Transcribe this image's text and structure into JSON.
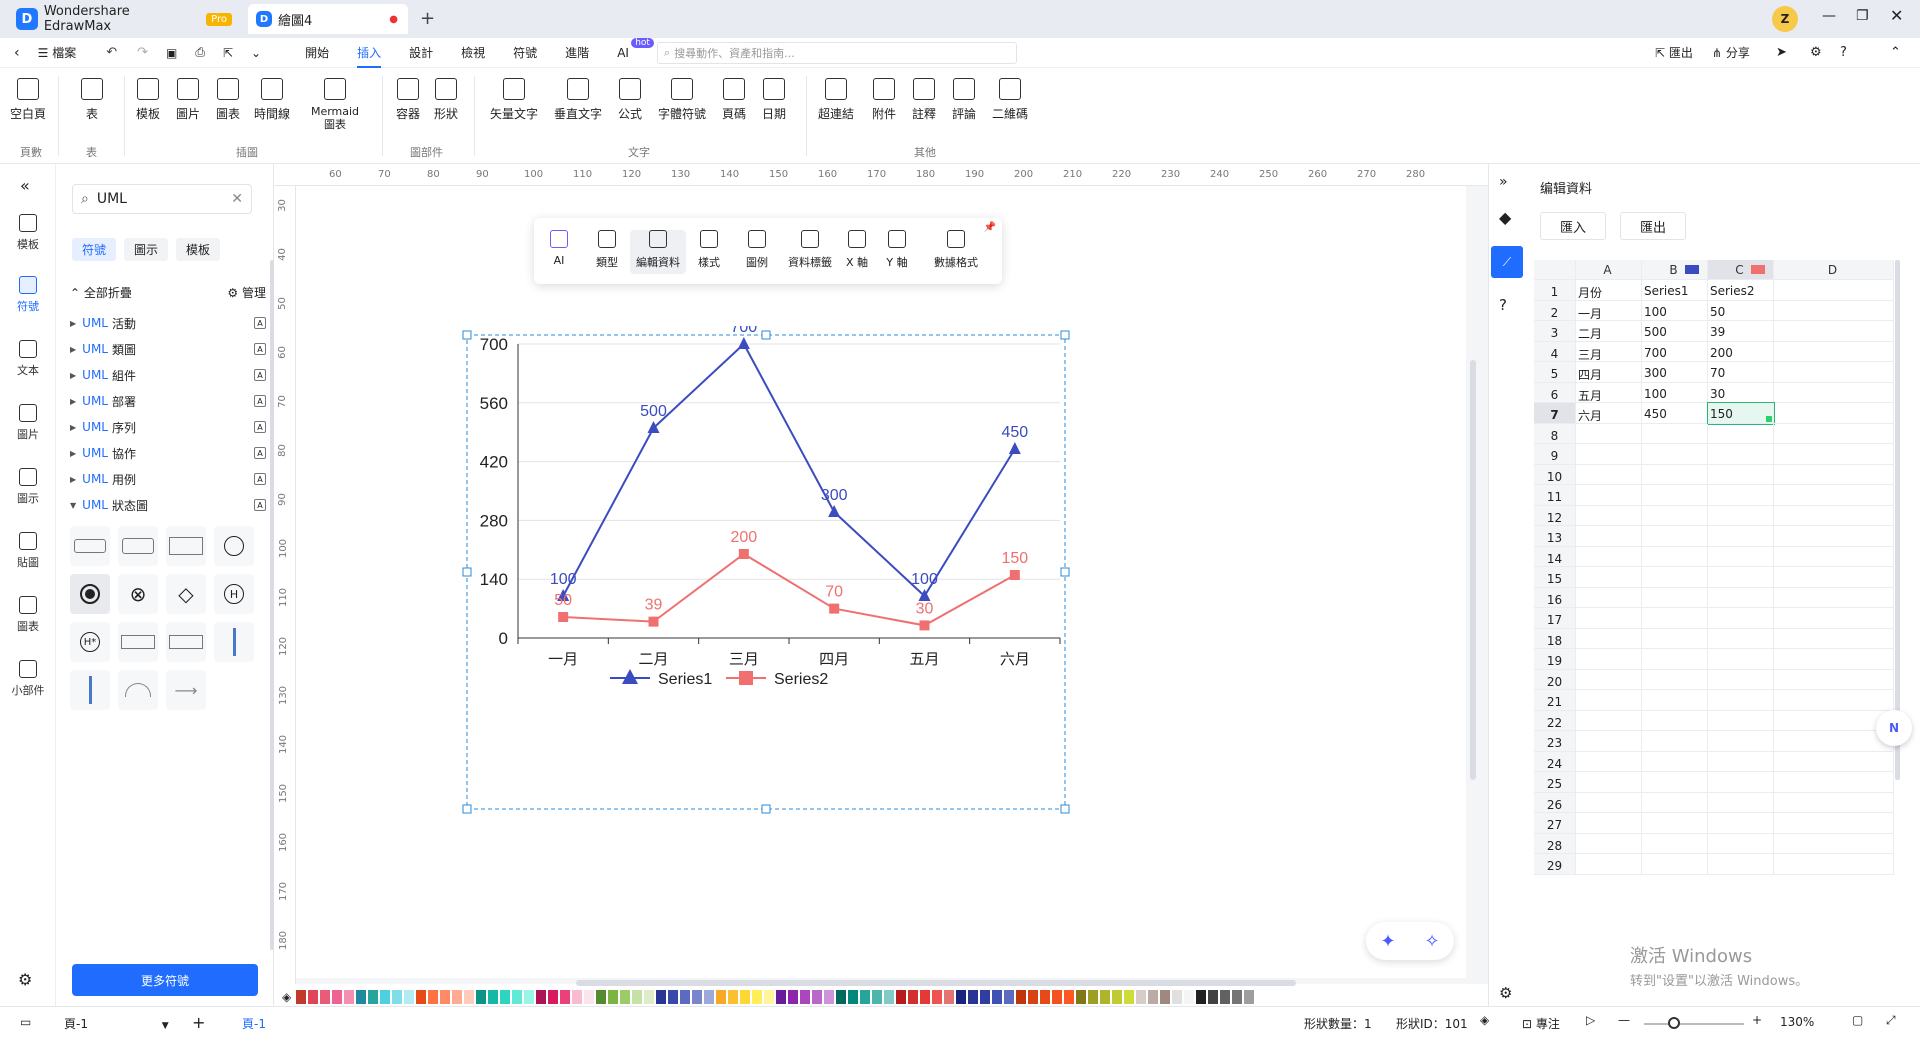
{
  "app": {
    "tab_app": "Wondershare EdrawMax",
    "pro_badge": "Pro",
    "tab_doc": "繪圖4",
    "user_initial": "Z"
  },
  "menu": {
    "file": "檔案",
    "items": [
      "開始",
      "插入",
      "設計",
      "檢視",
      "符號",
      "進階",
      "AI"
    ],
    "active": "插入",
    "ai_badge": "hot",
    "search_placeholder": "搜尋動作、資產和指南...",
    "export": "匯出",
    "share": "分享"
  },
  "ribbon": {
    "buttons": [
      "空白頁",
      "表",
      "模板",
      "圖片",
      "圖表",
      "時間線",
      "Mermaid 圖表",
      "容器",
      "形狀",
      "矢量文字",
      "垂直文字",
      "公式",
      "字體符號",
      "頁碼",
      "日期",
      "超連結",
      "附件",
      "註釋",
      "評論",
      "二維碼"
    ],
    "groups": [
      "頁數",
      "表",
      "插圖",
      "圖部件",
      "文字",
      "其他"
    ]
  },
  "rail": {
    "items": [
      "模板",
      "符號",
      "文本",
      "圖片",
      "圖示",
      "貼圖",
      "圖表",
      "小部件"
    ],
    "active": "符號"
  },
  "panel": {
    "search_value": "UML",
    "tabs": [
      "符號",
      "圖示",
      "模板"
    ],
    "collapse_all": "全部折疊",
    "manage": "管理",
    "uml_prefix": "UML",
    "categories": [
      "活動",
      "類圖",
      "組件",
      "部署",
      "序列",
      "協作",
      "用例",
      "狀态圖"
    ],
    "more_symbols": "更多符號"
  },
  "float_toolbar": {
    "items": [
      "AI",
      "類型",
      "編輯資料",
      "樣式",
      "圖例",
      "資料標籤",
      "X 軸",
      "Y 軸",
      "數據格式"
    ]
  },
  "ruler_h": [
    "60",
    "70",
    "80",
    "90",
    "100",
    "110",
    "120",
    "130",
    "140",
    "150",
    "160",
    "170",
    "180",
    "190",
    "200",
    "210",
    "220",
    "230",
    "240",
    "250",
    "260",
    "270",
    "280"
  ],
  "ruler_v": [
    "30",
    "40",
    "50",
    "60",
    "70",
    "80",
    "90",
    "100",
    "110",
    "120",
    "130",
    "140",
    "150",
    "160",
    "170",
    "180"
  ],
  "chart_data": {
    "type": "line",
    "categories": [
      "一月",
      "二月",
      "三月",
      "四月",
      "五月",
      "六月"
    ],
    "series": [
      {
        "name": "Series1",
        "values": [
          100,
          500,
          700,
          300,
          100,
          450
        ],
        "color": "#3b4cc0"
      },
      {
        "name": "Series2",
        "values": [
          50,
          39,
          200,
          70,
          30,
          150
        ],
        "color": "#f07070"
      }
    ],
    "yticks": [
      0,
      140,
      280,
      420,
      560,
      700
    ],
    "ylim": [
      0,
      700
    ],
    "legend": "bottom"
  },
  "datapanel": {
    "title": "编辑資料",
    "import": "匯入",
    "export": "匯出",
    "cols": [
      "A",
      "B",
      "C",
      "D"
    ],
    "rows": [
      [
        "月份",
        "Series1",
        "Series2"
      ],
      [
        "一月",
        "100",
        "50"
      ],
      [
        "二月",
        "500",
        "39"
      ],
      [
        "三月",
        "700",
        "200"
      ],
      [
        "四月",
        "300",
        "70"
      ],
      [
        "五月",
        "100",
        "30"
      ],
      [
        "六月",
        "450",
        "150"
      ]
    ],
    "row_count": 29
  },
  "status": {
    "page_tab": "頁-1",
    "page_tab_active": "頁-1",
    "shape_count": "形狀數量：1",
    "shape_id": "形狀ID：101",
    "focus": "專注",
    "zoom": "130%"
  },
  "watermark": {
    "line1": "激活 Windows",
    "line2": "转到\"设置\"以激活 Windows。"
  }
}
